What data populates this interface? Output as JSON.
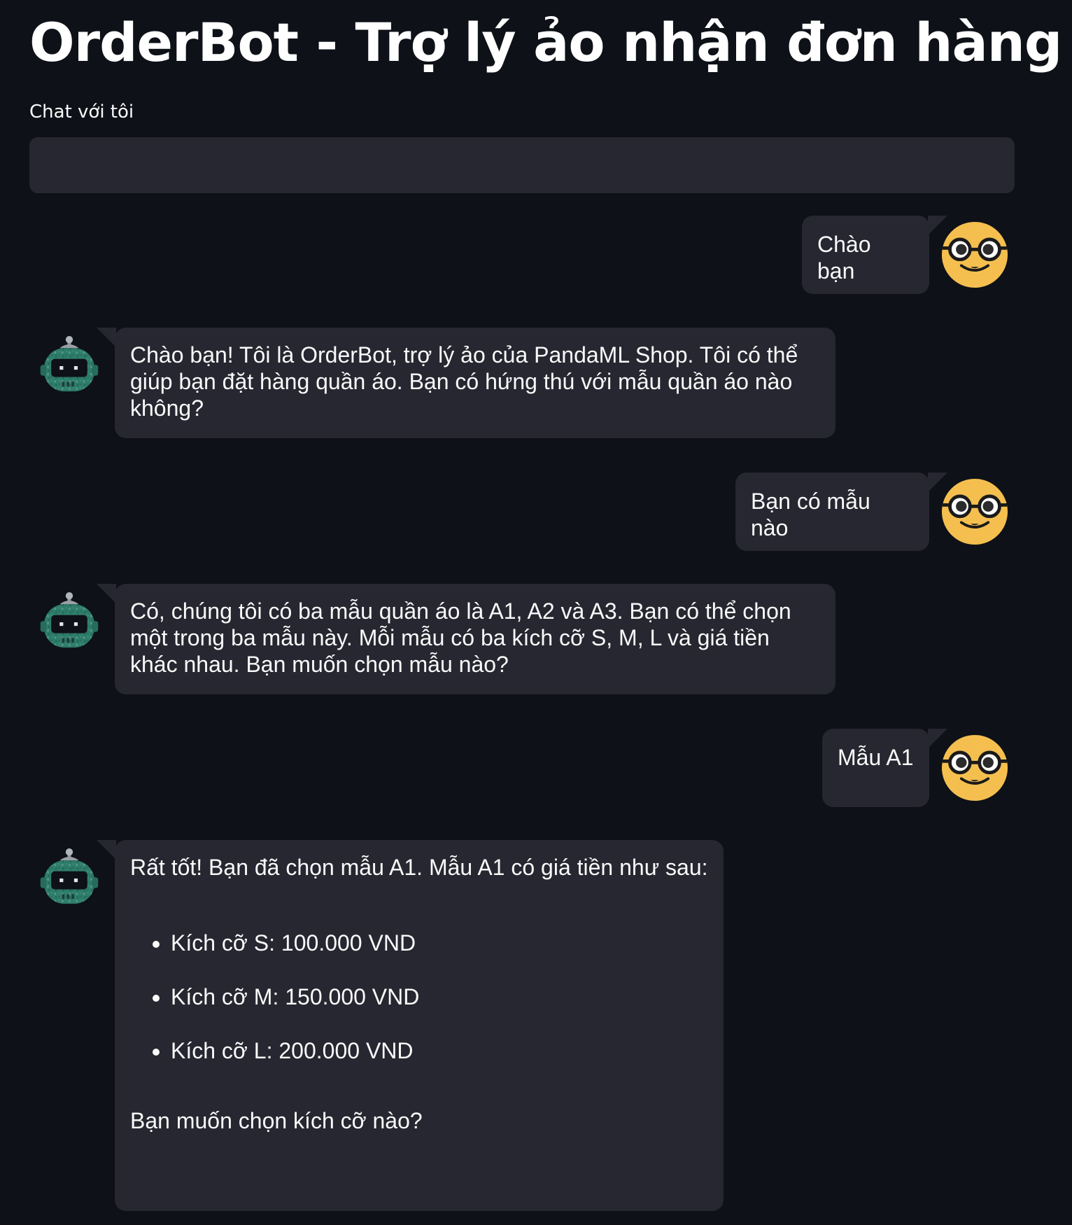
{
  "app": {
    "title": "OrderBot - Trợ lý ảo nhận đơn hàng"
  },
  "input": {
    "label": "Chat với tôi",
    "value": "",
    "placeholder": ""
  },
  "messages": [
    {
      "role": "user",
      "text": "Chào bạn"
    },
    {
      "role": "bot",
      "text": "Chào bạn! Tôi là OrderBot, trợ lý ảo của PandaML Shop. Tôi có thể giúp bạn đặt hàng quần áo. Bạn có hứng thú với mẫu quần áo nào không?"
    },
    {
      "role": "user",
      "text": "Bạn có mẫu nào"
    },
    {
      "role": "bot",
      "text": "Có, chúng tôi có ba mẫu quần áo là A1, A2 và A3. Bạn có thể chọn một trong ba mẫu này. Mỗi mẫu có ba kích cỡ S, M, L và giá tiền khác nhau. Bạn muốn chọn mẫu nào?"
    },
    {
      "role": "user",
      "text": "Mẫu A1"
    },
    {
      "role": "bot",
      "intro": "Rất tốt! Bạn đã chọn mẫu A1. Mẫu A1 có giá tiền như sau:",
      "items": [
        "Kích cỡ S: 100.000 VND",
        "Kích cỡ M: 150.000 VND",
        "Kích cỡ L: 200.000 VND"
      ],
      "outro": "Bạn muốn chọn kích cỡ nào?"
    }
  ],
  "colors": {
    "background": "#0e1117",
    "bubble": "#262730",
    "text": "#fafafa",
    "user_avatar": "#f4bf4f",
    "bot_avatar": "#2e7d6b"
  },
  "icons": {
    "user_avatar": "nerd-face-icon",
    "bot_avatar": "robot-icon"
  }
}
